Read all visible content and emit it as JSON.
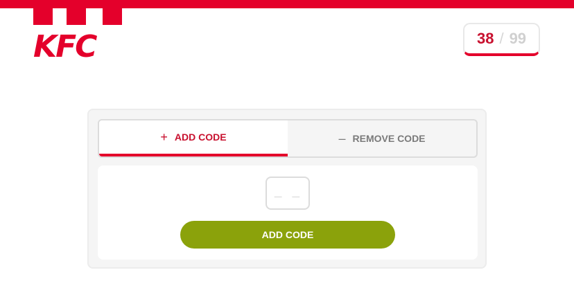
{
  "brand": {
    "logo_text": "KFC",
    "accent_color": "#e4002b",
    "button_color": "#8ba20b"
  },
  "counter": {
    "current": "38",
    "separator": "/",
    "max": "99"
  },
  "tabs": [
    {
      "icon": "plus-icon",
      "glyph": "+",
      "label": "ADD CODE",
      "active": true
    },
    {
      "icon": "minus-icon",
      "glyph": "–",
      "label": "REMOVE CODE",
      "active": false
    }
  ],
  "code_input": {
    "placeholder": "_ _",
    "value": ""
  },
  "submit": {
    "label": "ADD CODE"
  }
}
